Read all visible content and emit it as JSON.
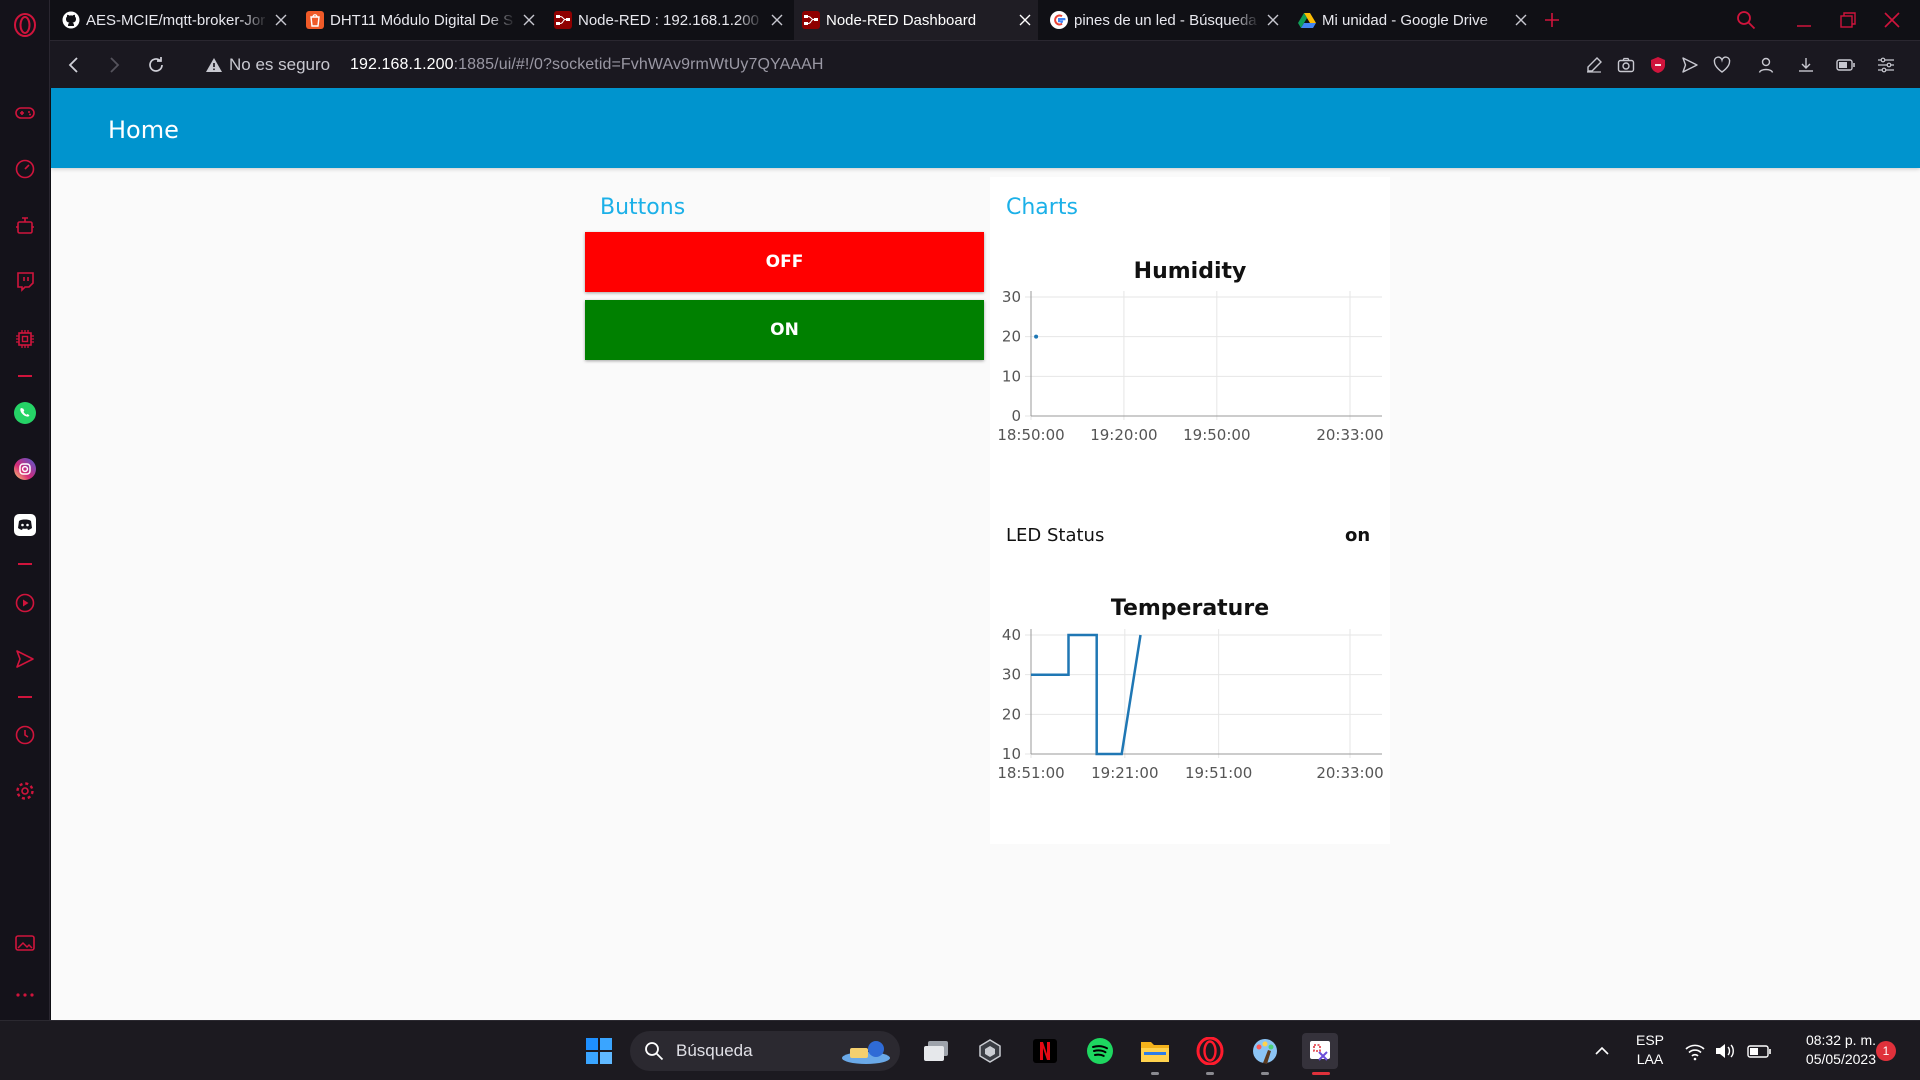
{
  "browser": {
    "tabs": [
      {
        "title": "AES-MCIE/mqtt-broker-Jor",
        "icon": "github-icon",
        "active": false
      },
      {
        "title": "DHT11 Módulo Digital De S",
        "icon": "store-icon",
        "active": false
      },
      {
        "title": "Node-RED : 192.168.1.200",
        "icon": "node-red-icon",
        "active": false
      },
      {
        "title": "Node-RED Dashboard",
        "icon": "node-red-icon",
        "active": true
      },
      {
        "title": "pines de un led - Búsqueda",
        "icon": "google-icon",
        "active": false
      },
      {
        "title": "Mi unidad - Google Drive",
        "icon": "google-drive-icon",
        "active": false
      }
    ],
    "security_label": "No es seguro",
    "url_host": "192.168.1.200",
    "url_rest": ":1885/ui/#!/0?socketid=FvhWAv9rmWtUy7QYAAAH",
    "accent": "#d0143c"
  },
  "dashboard": {
    "title": "Home",
    "header_color": "#0094ce",
    "groups": {
      "buttons": {
        "title": "Buttons",
        "off_label": "OFF",
        "on_label": "ON",
        "off_color": "#ff0000",
        "on_color": "#008000"
      },
      "charts": {
        "title": "Charts",
        "led_label": "LED Status",
        "led_value": "on"
      }
    }
  },
  "chart_data": [
    {
      "type": "scatter",
      "title": "Humidity",
      "x_ticks": [
        "18:50:00",
        "19:20:00",
        "19:50:00",
        "20:33:00"
      ],
      "y_ticks": [
        "0",
        "10",
        "20",
        "30"
      ],
      "ylim": [
        0,
        30
      ],
      "grid": true,
      "series": [
        {
          "points": [
            {
              "x": "18:51:00",
              "y": 20
            }
          ],
          "color": "#1f77b4"
        }
      ]
    },
    {
      "type": "line",
      "title": "Temperature",
      "x_ticks": [
        "18:51:00",
        "19:21:00",
        "19:51:00",
        "20:33:00"
      ],
      "y_ticks": [
        "10",
        "20",
        "30",
        "40"
      ],
      "ylim": [
        10,
        40
      ],
      "grid": true,
      "series": [
        {
          "color": "#1f77b4",
          "step": true,
          "points": [
            {
              "x": "18:51:00",
              "y": 30
            },
            {
              "x": "19:03:00",
              "y": 30
            },
            {
              "x": "19:03:00",
              "y": 40
            },
            {
              "x": "19:12:00",
              "y": 40
            },
            {
              "x": "19:12:00",
              "y": 10
            },
            {
              "x": "19:20:00",
              "y": 10
            },
            {
              "x": "19:26:00",
              "y": 40
            }
          ]
        }
      ]
    }
  ],
  "taskbar": {
    "search_label": "Búsqueda",
    "lang_line1": "ESP",
    "lang_line2": "LAA",
    "time": "08:32 p. m.",
    "date": "05/05/2023",
    "notification_count": "1"
  }
}
